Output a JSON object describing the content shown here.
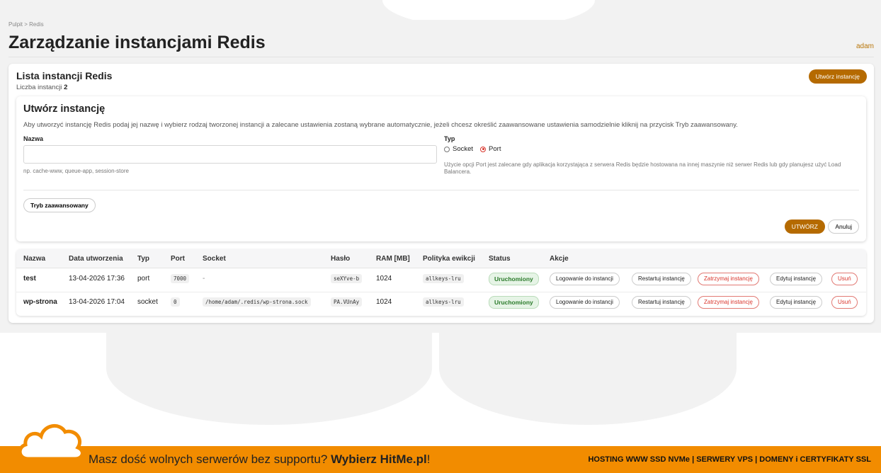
{
  "breadcrumb": {
    "home": "Pulpit",
    "sep": ">",
    "current": "Redis"
  },
  "page_title": "Zarządzanie instancjami Redis",
  "user": "adam",
  "list": {
    "title": "Lista instancji Redis",
    "count_label": "Liczba instancji",
    "count": "2",
    "create_button": "Utwórz instancję"
  },
  "form": {
    "title": "Utwórz instancję",
    "description": "Aby utworzyć instancję Redis podaj jej nazwę i wybierz rodzaj tworzonej instancji a zalecane ustawienia zostaną wybrane automatycznie, jeżeli chcesz określić zaawansowane ustawienia samodzielnie kliknij na przycisk Tryb zaawansowany.",
    "name_label": "Nazwa",
    "name_value": "",
    "name_hint": "np. cache-www, queue-app, session-store",
    "type_label": "Typ",
    "type_options": [
      "Socket",
      "Port"
    ],
    "type_selected": "Port",
    "type_hint": "Użycie opcji Port jest zalecane gdy aplikacja korzystająca z serwera Redis będzie hostowana na innej maszynie niż serwer Redis lub gdy planujesz użyć Load Balancera.",
    "advanced_button": "Tryb zaawansowany",
    "submit_button": "UTWÓRZ",
    "cancel_button": "Anuluj"
  },
  "table": {
    "columns": [
      "Nazwa",
      "Data utworzenia",
      "Typ",
      "Port",
      "Socket",
      "Hasło",
      "RAM [MB]",
      "Polityka ewikcji",
      "Status",
      "Akcje"
    ],
    "rows": [
      {
        "name": "test",
        "created": "13-04-2026 17:36",
        "type": "port",
        "port": "7000",
        "socket": "-",
        "password": "seXYve-b",
        "ram": "1024",
        "policy": "allkeys-lru",
        "status": "Uruchomiony"
      },
      {
        "name": "wp-strona",
        "created": "13-04-2026 17:04",
        "type": "socket",
        "port": "0",
        "socket": "/home/adam/.redis/wp-strona.sock",
        "password": "PA.VUnAy",
        "ram": "1024",
        "policy": "allkeys-lru",
        "status": "Uruchomiony"
      }
    ],
    "actions": [
      "Logowanie do instancji",
      "Restartuj instancję",
      "Zatrzymaj instancję",
      "Edytuj instancję",
      "Usuń"
    ]
  },
  "banner": {
    "text": "Masz dość wolnych serwerów bez supportu?",
    "cta": "Wybierz HitMe.pl",
    "bang": "!",
    "right": "HOSTING WWW SSD NVMe | SERWERY VPS | DOMENY i CERTYFIKATY SSL"
  },
  "colors": {
    "accent": "#b56a00",
    "danger": "#d9342b",
    "banner": "#f28c00",
    "success": "#2a7a2a"
  }
}
